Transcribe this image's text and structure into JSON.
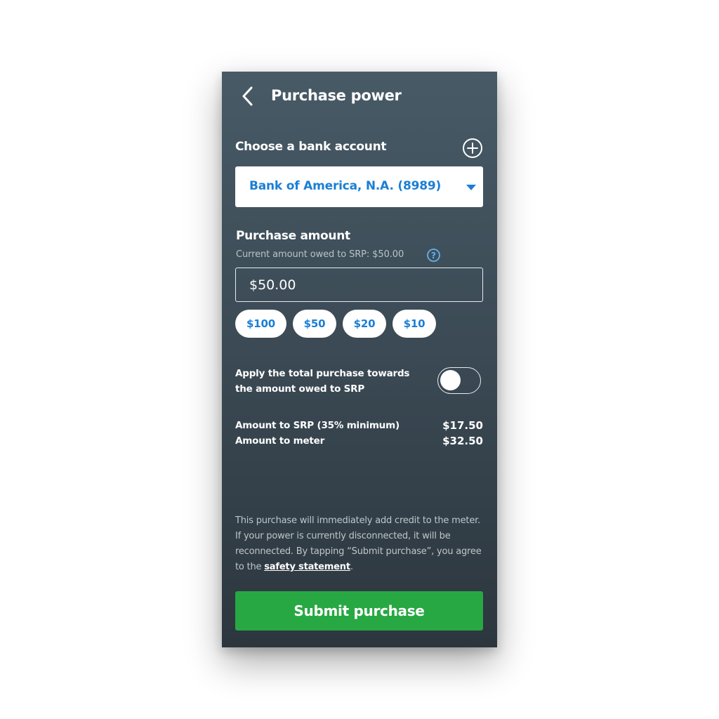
{
  "header": {
    "title": "Purchase power",
    "back_icon": "chevron-left-icon"
  },
  "bank": {
    "label": "Choose a bank account",
    "add_icon": "plus-circle-icon",
    "selected": "Bank of America, N.A. (8989)",
    "dropdown_icon": "caret-down-icon"
  },
  "amount": {
    "label": "Purchase amount",
    "owed_text": "Current amount owed to SRP: $50.00",
    "help_icon": "question-circle-icon",
    "value": "$50.00",
    "quick_amounts": [
      "$100",
      "$50",
      "$20",
      "$10"
    ]
  },
  "toggle": {
    "label": "Apply the total purchase towards the amount owed to SRP",
    "on": false
  },
  "breakdown": {
    "srp_label": "Amount to SRP (35% minimum)",
    "srp_value": "$17.50",
    "meter_label": "Amount to meter",
    "meter_value": "$32.50"
  },
  "disclaimer": {
    "text_before": "This purchase will immediately add credit to the meter. If your power is currently disconnected, it will be reconnected. By tapping “Submit purchase”, you agree to the ",
    "link": "safety statement",
    "text_after": "."
  },
  "submit_label": "Submit purchase",
  "colors": {
    "accent_blue": "#1a7fd4",
    "submit_green": "#27a843",
    "background_top": "#475a66",
    "background_bottom": "#2c363e"
  }
}
